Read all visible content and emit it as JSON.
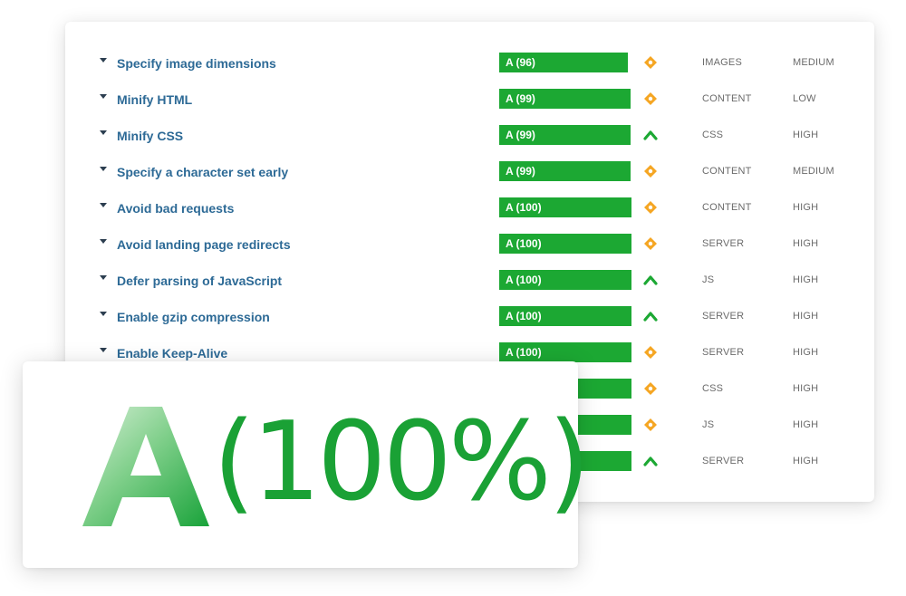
{
  "recommendations": [
    {
      "name": "Specify image dimensions",
      "grade": "A (96)",
      "score": 96,
      "trend": "neutral",
      "type": "IMAGES",
      "priority": "MEDIUM"
    },
    {
      "name": "Minify HTML",
      "grade": "A (99)",
      "score": 99,
      "trend": "neutral",
      "type": "CONTENT",
      "priority": "LOW"
    },
    {
      "name": "Minify CSS",
      "grade": "A (99)",
      "score": 99,
      "trend": "up",
      "type": "CSS",
      "priority": "HIGH"
    },
    {
      "name": "Specify a character set early",
      "grade": "A (99)",
      "score": 99,
      "trend": "neutral",
      "type": "CONTENT",
      "priority": "MEDIUM"
    },
    {
      "name": "Avoid bad requests",
      "grade": "A (100)",
      "score": 100,
      "trend": "neutral",
      "type": "CONTENT",
      "priority": "HIGH"
    },
    {
      "name": "Avoid landing page redirects",
      "grade": "A (100)",
      "score": 100,
      "trend": "neutral",
      "type": "SERVER",
      "priority": "HIGH"
    },
    {
      "name": "Defer parsing of JavaScript",
      "grade": "A (100)",
      "score": 100,
      "trend": "up",
      "type": "JS",
      "priority": "HIGH"
    },
    {
      "name": "Enable gzip compression",
      "grade": "A (100)",
      "score": 100,
      "trend": "up",
      "type": "SERVER",
      "priority": "HIGH"
    },
    {
      "name": "Enable Keep-Alive",
      "grade": "A (100)",
      "score": 100,
      "trend": "neutral",
      "type": "SERVER",
      "priority": "HIGH"
    },
    {
      "name": "",
      "grade": "",
      "score": 100,
      "trend": "neutral",
      "type": "CSS",
      "priority": "HIGH"
    },
    {
      "name": "",
      "grade": "",
      "score": 100,
      "trend": "neutral",
      "type": "JS",
      "priority": "HIGH"
    },
    {
      "name": "",
      "grade": "",
      "score": 100,
      "trend": "up",
      "type": "SERVER",
      "priority": "HIGH"
    }
  ],
  "overall": {
    "letter": "A",
    "percent": "(100%)"
  },
  "colors": {
    "grade_green": "#1ca833",
    "link_blue": "#2d6a96",
    "neutral_orange": "#f5a623",
    "up_green": "#1ca833"
  },
  "icons": {
    "neutral": "diamond-icon",
    "up": "chevron-up-icon"
  }
}
